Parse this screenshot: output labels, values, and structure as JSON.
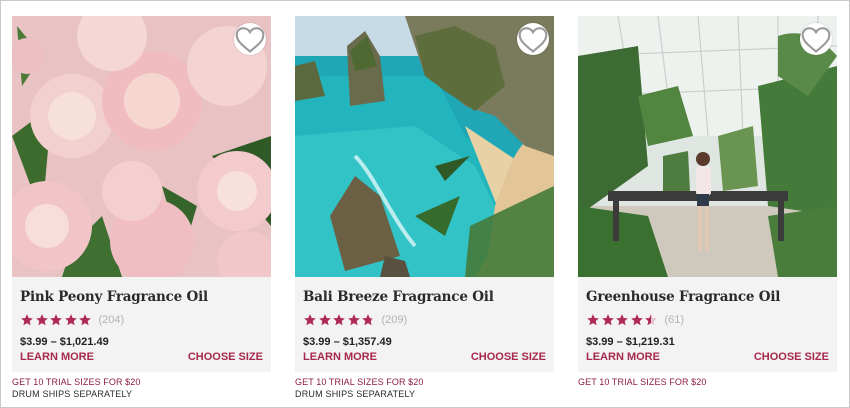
{
  "colors": {
    "accent": "#a7284e",
    "star": "#b02a58",
    "panel": "#f3f3f3"
  },
  "products": [
    {
      "title": "Pink Peony Fragrance Oil",
      "rating": 5,
      "rating_count": "(204)",
      "price": "$3.99 – $1,021.49",
      "learn_more": "LEARN MORE",
      "choose_size": "CHOOSE SIZE",
      "trial": "GET 10 TRIAL SIZES FOR $20",
      "drum": "DRUM SHIPS SEPARATELY",
      "image": "pink-peony-flowers-image",
      "favorite_icon": "heart-icon"
    },
    {
      "title": "Bali Breeze Fragrance Oil",
      "rating": 4.8,
      "rating_count": "(209)",
      "price": "$3.99 – $1,357.49",
      "learn_more": "LEARN MORE",
      "choose_size": "CHOOSE SIZE",
      "trial": "GET 10 TRIAL SIZES FOR $20",
      "drum": "DRUM SHIPS SEPARATELY",
      "image": "bali-beach-cove-image",
      "favorite_icon": "heart-icon"
    },
    {
      "title": "Greenhouse Fragrance Oil",
      "rating": 4.5,
      "rating_count": "(61)",
      "price": "$3.99 – $1,219.31",
      "learn_more": "LEARN MORE",
      "choose_size": "CHOOSE SIZE",
      "trial": "GET 10 TRIAL SIZES FOR $20",
      "drum": "",
      "image": "greenhouse-plants-image",
      "favorite_icon": "heart-icon"
    }
  ]
}
